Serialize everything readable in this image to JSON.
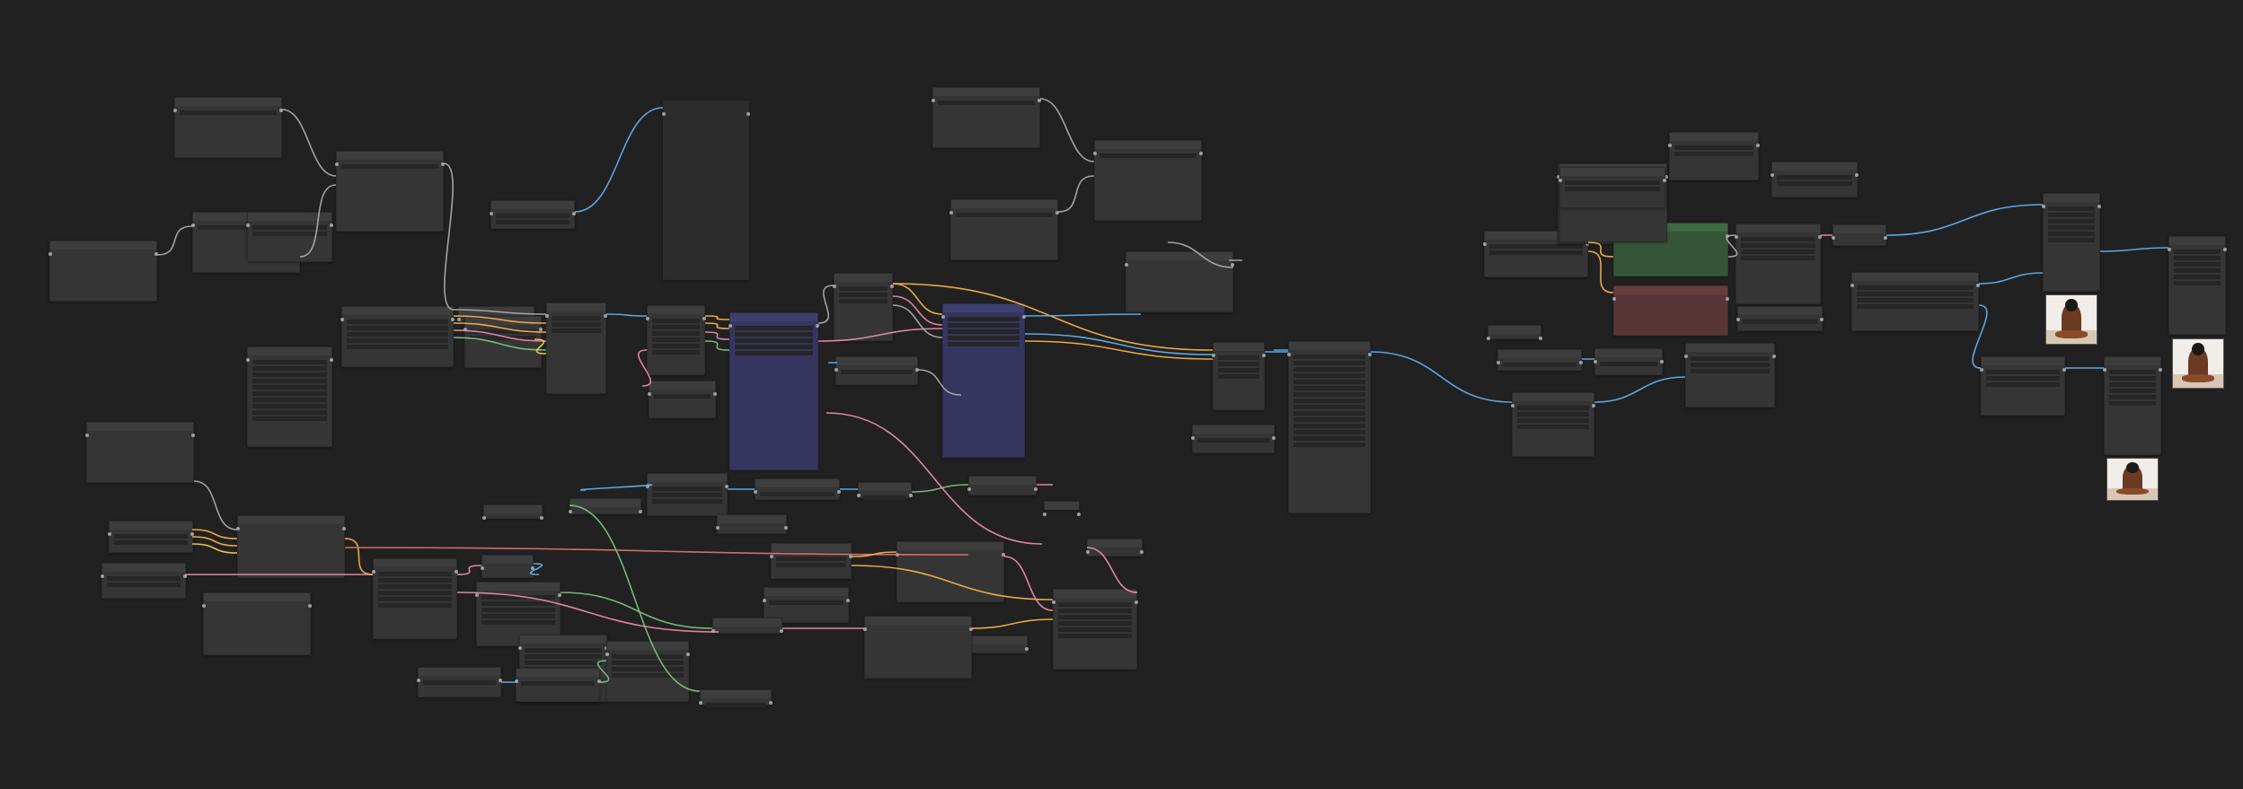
{
  "app": {
    "canvas_background": "#212121"
  },
  "colors": {
    "wire_blue": "#64b5f6",
    "wire_orange": "#ffb74d",
    "wire_pink": "#f48fb1",
    "wire_green": "#81c784",
    "wire_gray": "#b0b0b0",
    "wire_red": "#e57373",
    "wire_yellow": "#ffd54f",
    "node_purple": "#353560",
    "node_green": "#355636",
    "node_red": "#593636"
  },
  "icons": {
    "preview_image": "image-preview-icon",
    "slot": "connection-slot-icon"
  }
}
